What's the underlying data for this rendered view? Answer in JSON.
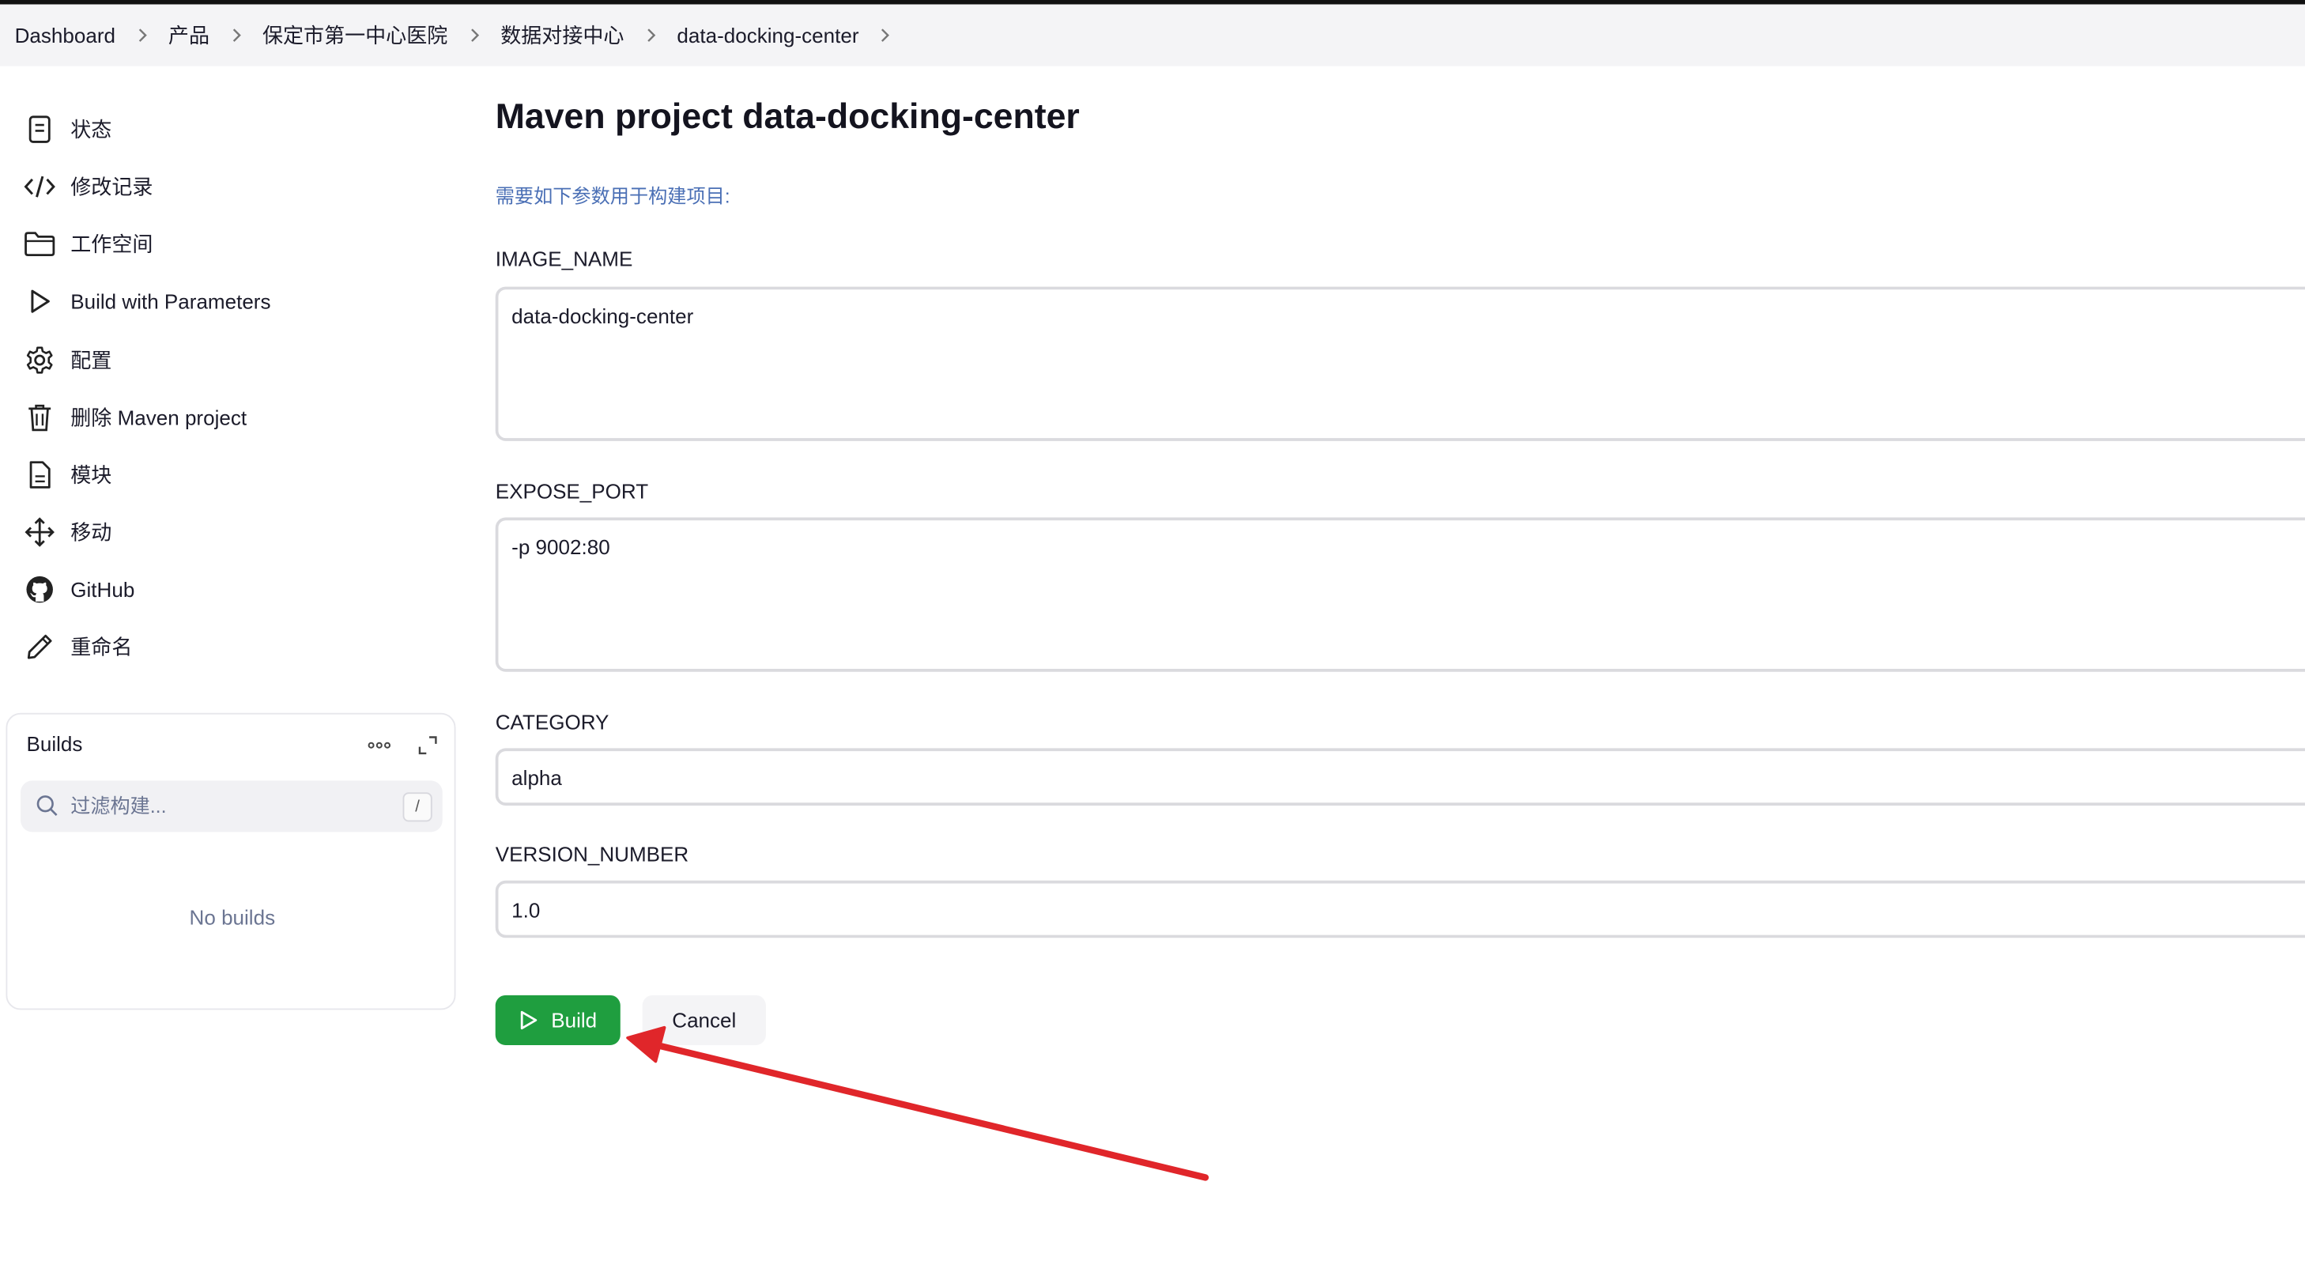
{
  "breadcrumb": {
    "items": [
      "Dashboard",
      "产品",
      "保定市第一中心医院",
      "数据对接中心",
      "data-docking-center"
    ]
  },
  "sidebar": {
    "tasks": [
      {
        "label": "状态",
        "icon": "document-icon"
      },
      {
        "label": "修改记录",
        "icon": "code-icon"
      },
      {
        "label": "工作空间",
        "icon": "folder-icon"
      },
      {
        "label": "Build with Parameters",
        "icon": "play-icon"
      },
      {
        "label": "配置",
        "icon": "gear-icon"
      },
      {
        "label": "删除 Maven project",
        "icon": "trash-icon"
      },
      {
        "label": "模块",
        "icon": "file-icon"
      },
      {
        "label": "移动",
        "icon": "move-icon"
      },
      {
        "label": "GitHub",
        "icon": "github-icon"
      },
      {
        "label": "重命名",
        "icon": "pencil-icon"
      }
    ]
  },
  "builds": {
    "title": "Builds",
    "search_placeholder": "过滤构建...",
    "shortcut": "/",
    "empty_text": "No builds"
  },
  "main": {
    "title": "Maven project data-docking-center",
    "description": "需要如下参数用于构建项目:",
    "params": [
      {
        "name": "IMAGE_NAME",
        "value": "data-docking-center",
        "type": "textarea"
      },
      {
        "name": "EXPOSE_PORT",
        "value": "-p 9002:80",
        "type": "textarea"
      },
      {
        "name": "CATEGORY",
        "value": "alpha",
        "type": "text"
      },
      {
        "name": "VERSION_NUMBER",
        "value": "1.0",
        "type": "text"
      }
    ],
    "build_label": "Build",
    "cancel_label": "Cancel"
  },
  "colors": {
    "build_button": "#1f9e3f",
    "annotation_arrow": "#e0262a",
    "description_text": "#4a6fb5"
  }
}
